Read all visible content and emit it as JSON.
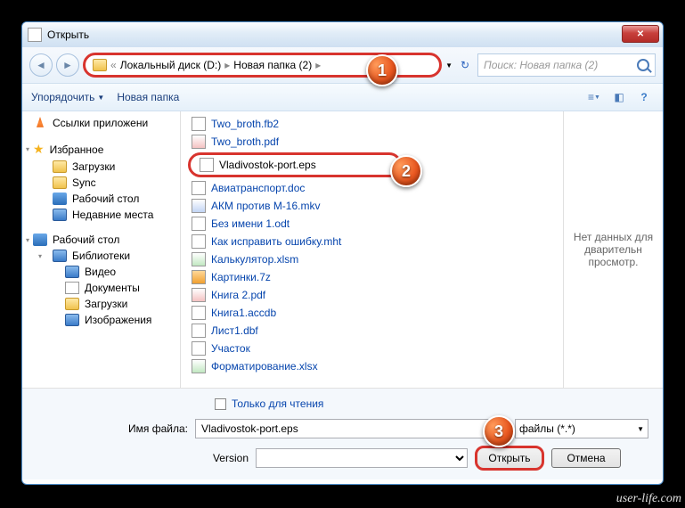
{
  "window": {
    "title": "Открыть"
  },
  "breadcrumb": {
    "prefix": "«",
    "items": [
      "Локальный диск (D:)",
      "Новая папка (2)"
    ]
  },
  "search": {
    "placeholder": "Поиск: Новая папка (2)"
  },
  "toolbar": {
    "organize": "Упорядочить",
    "newfolder": "Новая папка"
  },
  "sidebar": {
    "apps": {
      "label": "Ссылки приложени"
    },
    "favorites": {
      "label": "Избранное",
      "items": [
        "Загрузки",
        "Sync",
        "Рабочий стол",
        "Недавние места"
      ]
    },
    "desktop": {
      "label": "Рабочий стол"
    },
    "libraries": {
      "label": "Библиотеки",
      "items": [
        "Видео",
        "Документы",
        "Загрузки",
        "Изображения"
      ]
    }
  },
  "files": [
    {
      "name": "Two_broth.fb2",
      "icon": "doc"
    },
    {
      "name": "Two_broth.pdf",
      "icon": "pdf"
    },
    {
      "name": "Vladivostok-port.eps",
      "icon": "doc",
      "selected": true,
      "black": true
    },
    {
      "name": "Авиатранспорт.doc",
      "icon": "doc"
    },
    {
      "name": "АКМ против М-16.mkv",
      "icon": "mkv"
    },
    {
      "name": "Без имени 1.odt",
      "icon": "doc"
    },
    {
      "name": "Как исправить ошибку.mht",
      "icon": "doc"
    },
    {
      "name": "Калькулятор.xlsm",
      "icon": "xls"
    },
    {
      "name": "Картинки.7z",
      "icon": "7z"
    },
    {
      "name": "Книга 2.pdf",
      "icon": "pdf"
    },
    {
      "name": "Книга1.accdb",
      "icon": "doc"
    },
    {
      "name": "Лист1.dbf",
      "icon": "doc"
    },
    {
      "name": "Участок",
      "icon": "doc"
    },
    {
      "name": "Форматирование.xlsx",
      "icon": "xls"
    }
  ],
  "preview": {
    "text": "Нет данных для дварительн просмотр."
  },
  "readonly": {
    "label": "Только для чтения"
  },
  "filename": {
    "label": "Имя файла:",
    "value": "Vladivostok-port.eps"
  },
  "filetype": {
    "label": "файлы (*.*)"
  },
  "version": {
    "label": "Version"
  },
  "buttons": {
    "open": "Открыть",
    "cancel": "Отмена"
  },
  "badges": {
    "b1": "1",
    "b2": "2",
    "b3": "3"
  },
  "watermark": "user-life.com"
}
